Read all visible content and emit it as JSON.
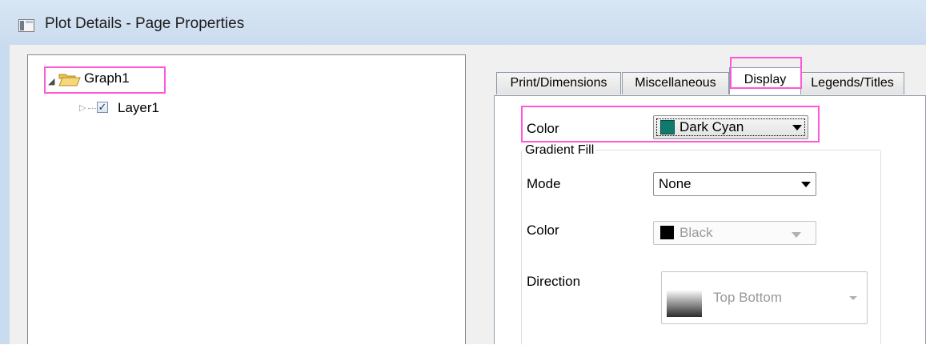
{
  "window": {
    "title": "Plot Details - Page Properties"
  },
  "tree": {
    "items": [
      {
        "label": "Graph1",
        "icon": "folder-open-icon",
        "expanded": true
      },
      {
        "label": "Layer1",
        "checked": true,
        "checkmark": "✓"
      }
    ]
  },
  "tabs": [
    {
      "label": "Print/Dimensions",
      "active": false
    },
    {
      "label": "Miscellaneous",
      "active": false
    },
    {
      "label": "Display",
      "active": true
    },
    {
      "label": "Legends/Titles",
      "active": false
    }
  ],
  "display": {
    "color_label": "Color",
    "color_value": "Dark Cyan",
    "color_swatch": "#0f7a6c",
    "gradient": {
      "title": "Gradient Fill",
      "mode_label": "Mode",
      "mode_value": "None",
      "color_label": "Color",
      "color_value": "Black",
      "color_swatch": "#000000",
      "direction_label": "Direction",
      "direction_value": "Top Bottom"
    }
  },
  "accent_highlight": "#ff57d8"
}
